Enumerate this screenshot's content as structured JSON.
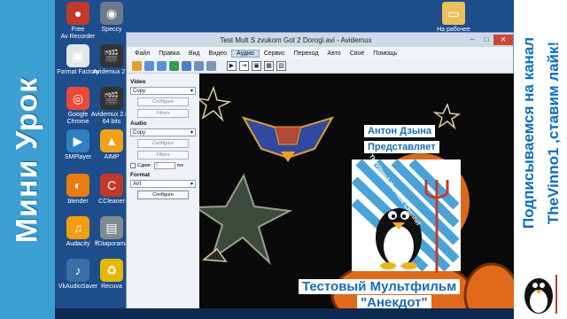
{
  "banner_left": {
    "text": "Мини Урок"
  },
  "banner_right": {
    "line1": "Подписываемся на канал",
    "line2": "TheVinno1 ,ставим лайк!"
  },
  "desktop": {
    "icons": [
      {
        "label": "Free Av Recorder",
        "glyph": "●",
        "color": "#c0392b"
      },
      {
        "label": "Speccy",
        "glyph": "◉",
        "color": "#6c7a89"
      },
      {
        "label": "Format Factory",
        "glyph": "▣",
        "color": "#e1e6ea"
      },
      {
        "label": "Avidemux 2.6",
        "glyph": "🎬",
        "color": "#333333"
      },
      {
        "label": "Google Chrome",
        "glyph": "◎",
        "color": "#e94a35"
      },
      {
        "label": "Avidemux 2.6 - 64 bits",
        "glyph": "🎬",
        "color": "#333333"
      },
      {
        "label": "SMPlayer",
        "glyph": "▶",
        "color": "#2f7fc1"
      },
      {
        "label": "AIMP",
        "glyph": "▲",
        "color": "#f0a21b"
      },
      {
        "label": "blender",
        "glyph": "◐",
        "color": "#e87d0d"
      },
      {
        "label": "CCleaner",
        "glyph": "C",
        "color": "#c0392b"
      },
      {
        "label": "Audacity",
        "glyph": "♫",
        "color": "#f39c12"
      },
      {
        "label": "ffDiaporama",
        "glyph": "▤",
        "color": "#7f8c8d"
      },
      {
        "label": "VkAudioSaver",
        "glyph": "♪",
        "color": "#3b6fa8"
      },
      {
        "label": "Recuva",
        "glyph": "♻",
        "color": "#e5b800"
      }
    ],
    "folder_label": "На рабочее место"
  },
  "window": {
    "title": "Test Mult S zvukom Got 2 Dorogi.avi - Avidemux",
    "minimize": "–",
    "maximize": "□",
    "close": "✕",
    "menu": [
      "Файл",
      "Правка",
      "Вид",
      "Видео",
      "Аудио",
      "Сервис",
      "Переход",
      "Авто",
      "Своё",
      "Помощь"
    ],
    "panel": {
      "video_heading": "Video",
      "video_codec": "Copy",
      "configure": "Configure",
      "filters": "Filters",
      "audio_heading": "Audio",
      "audio_codec": "Copy",
      "shift_label": "Сдвиг:",
      "shift_value": "0",
      "shift_unit": "ms",
      "format_heading": "Format",
      "format_value": "AVI"
    }
  },
  "preview": {
    "author": "Антон Дзына",
    "presents": "Представляет",
    "card_text": "TheVinno1 YouTube Channel",
    "cartoon_title_1": "Тестовый Мультфильм",
    "cartoon_title_2": "\"Анекдот\""
  },
  "colors": {
    "accent": "#3b9fd2",
    "brand_blue": "#1a6bb8"
  }
}
